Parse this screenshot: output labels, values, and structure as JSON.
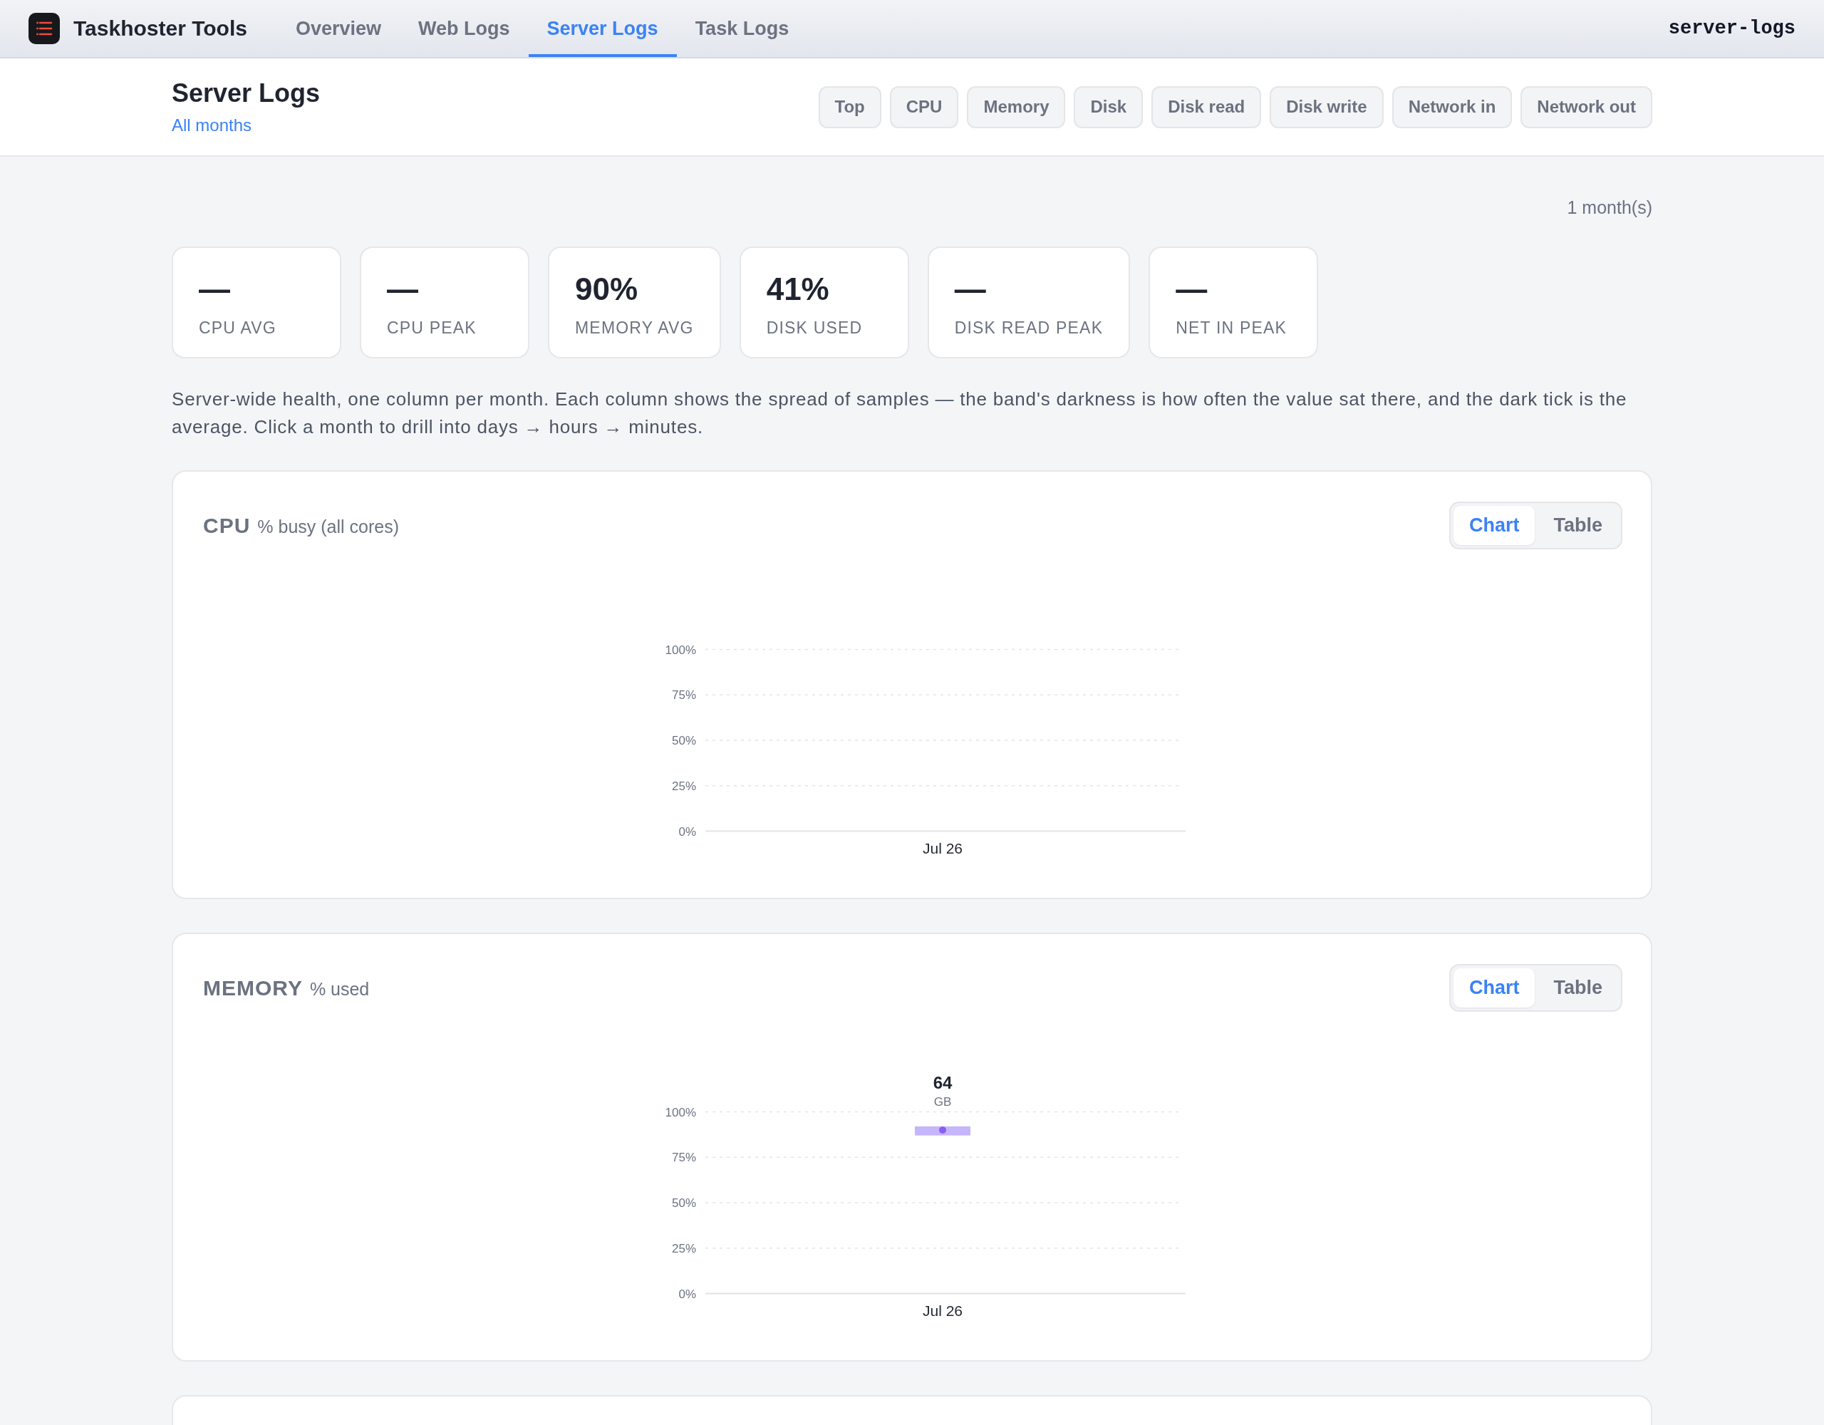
{
  "nav": {
    "app_name": "Taskhoster Tools",
    "tabs": [
      {
        "label": "Overview",
        "selected": false
      },
      {
        "label": "Web Logs",
        "selected": false
      },
      {
        "label": "Server Logs",
        "selected": true
      },
      {
        "label": "Task Logs",
        "selected": false
      }
    ],
    "page_slug": "server-logs"
  },
  "header": {
    "title": "Server Logs",
    "breadcrumb_link": "All months",
    "metric_buttons": [
      "Top",
      "CPU",
      "Memory",
      "Disk",
      "Disk read",
      "Disk write",
      "Network in",
      "Network out"
    ]
  },
  "range_summary": "1 month(s)",
  "stats": [
    {
      "value": "—",
      "label": "CPU AVG"
    },
    {
      "value": "—",
      "label": "CPU PEAK"
    },
    {
      "value": "90%",
      "label": "MEMORY AVG"
    },
    {
      "value": "41%",
      "label": "DISK USED"
    },
    {
      "value": "—",
      "label": "DISK READ PEAK"
    },
    {
      "value": "—",
      "label": "NET IN PEAK"
    }
  ],
  "description": "Server-wide health, one column per month. Each column shows the spread of samples — the band's darkness is how often the value sat there, and the dark tick is the average. Click a month to drill into days → hours → minutes.",
  "charts": [
    {
      "title": "CPU",
      "subtitle": "% busy (all cores)",
      "view_toggle": [
        {
          "label": "Chart",
          "selected": true
        },
        {
          "label": "Table",
          "selected": false
        }
      ],
      "chart_data": {
        "type": "scatter",
        "categories": [
          "Jul 26"
        ],
        "ylim": [
          0,
          100
        ],
        "yticks": [
          {
            "value": 0,
            "label": "0%"
          },
          {
            "value": 25,
            "label": "25%"
          },
          {
            "value": 50,
            "label": "50%"
          },
          {
            "value": 75,
            "label": "75%"
          },
          {
            "value": 100,
            "label": "100%"
          }
        ],
        "grid": true
      }
    },
    {
      "title": "MEMORY",
      "subtitle": "% used",
      "view_toggle": [
        {
          "label": "Chart",
          "selected": true
        },
        {
          "label": "Table",
          "selected": false
        }
      ],
      "chart_data": {
        "type": "scatter",
        "categories": [
          "Jul 26"
        ],
        "ylim": [
          0,
          100
        ],
        "yticks": [
          {
            "value": 0,
            "label": "0%"
          },
          {
            "value": 25,
            "label": "25%"
          },
          {
            "value": 50,
            "label": "50%"
          },
          {
            "value": 75,
            "label": "75%"
          },
          {
            "value": 100,
            "label": "100%"
          }
        ],
        "grid": true,
        "series": [
          {
            "color": "#8b5cf6",
            "values": [
              90
            ]
          }
        ],
        "bands": [
          {
            "axis": "y",
            "from": 87,
            "to": 92,
            "color": "#c4b5fd"
          }
        ],
        "annotations": [
          "64",
          "GB"
        ]
      }
    }
  ]
}
